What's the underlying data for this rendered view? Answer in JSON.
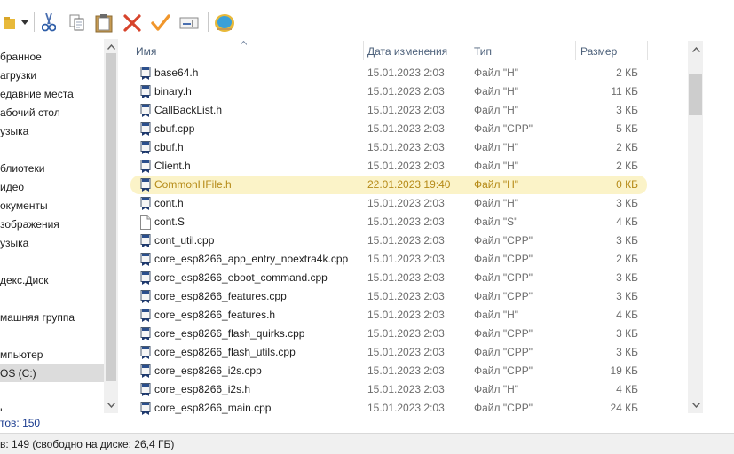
{
  "toolbar": {
    "icons": [
      "folder-icon",
      "dropdown-icon",
      "cut-icon",
      "copy-icon",
      "paste-icon",
      "delete-icon",
      "check-icon",
      "rename-icon",
      "shell-icon"
    ],
    "accent": "#d7442c"
  },
  "nav": {
    "items": [
      {
        "label": "бранное"
      },
      {
        "label": "агрузки"
      },
      {
        "label": "едавние места"
      },
      {
        "label": "абочий стол"
      },
      {
        "label": "узыка"
      },
      {
        "label": "блиотеки"
      },
      {
        "label": "идео"
      },
      {
        "label": "окументы"
      },
      {
        "label": "зображения"
      },
      {
        "label": "узыка"
      },
      {
        "label": "декс.Диск"
      },
      {
        "label": "машняя группа"
      },
      {
        "label": "мпьютер"
      },
      {
        "label": "OS (C:)"
      },
      {
        "label": "ь"
      }
    ],
    "status": "тов: 150"
  },
  "list": {
    "columns": {
      "name": "Имя",
      "date": "Дата изменения",
      "type": "Тип",
      "size": "Размер"
    },
    "rows": [
      {
        "name": "base64.h",
        "date": "15.01.2023 2:03",
        "type": "Файл \"H\"",
        "size": "2 КБ",
        "icon": "header-file"
      },
      {
        "name": "binary.h",
        "date": "15.01.2023 2:03",
        "type": "Файл \"H\"",
        "size": "11 КБ",
        "icon": "header-file"
      },
      {
        "name": "CallBackList.h",
        "date": "15.01.2023 2:03",
        "type": "Файл \"H\"",
        "size": "3 КБ",
        "icon": "header-file"
      },
      {
        "name": "cbuf.cpp",
        "date": "15.01.2023 2:03",
        "type": "Файл \"CPP\"",
        "size": "5 КБ",
        "icon": "header-file"
      },
      {
        "name": "cbuf.h",
        "date": "15.01.2023 2:03",
        "type": "Файл \"H\"",
        "size": "2 КБ",
        "icon": "header-file"
      },
      {
        "name": "Client.h",
        "date": "15.01.2023 2:03",
        "type": "Файл \"H\"",
        "size": "2 КБ",
        "icon": "header-file"
      },
      {
        "name": "CommonHFile.h",
        "date": "22.01.2023 19:40",
        "type": "Файл \"H\"",
        "size": "0 КБ",
        "icon": "header-file",
        "highlight": true
      },
      {
        "name": "cont.h",
        "date": "15.01.2023 2:03",
        "type": "Файл \"H\"",
        "size": "3 КБ",
        "icon": "header-file"
      },
      {
        "name": "cont.S",
        "date": "15.01.2023 2:03",
        "type": "Файл \"S\"",
        "size": "4 КБ",
        "icon": "blank-file"
      },
      {
        "name": "cont_util.cpp",
        "date": "15.01.2023 2:03",
        "type": "Файл \"CPP\"",
        "size": "3 КБ",
        "icon": "header-file"
      },
      {
        "name": "core_esp8266_app_entry_noextra4k.cpp",
        "date": "15.01.2023 2:03",
        "type": "Файл \"CPP\"",
        "size": "2 КБ",
        "icon": "header-file"
      },
      {
        "name": "core_esp8266_eboot_command.cpp",
        "date": "15.01.2023 2:03",
        "type": "Файл \"CPP\"",
        "size": "3 КБ",
        "icon": "header-file"
      },
      {
        "name": "core_esp8266_features.cpp",
        "date": "15.01.2023 2:03",
        "type": "Файл \"CPP\"",
        "size": "3 КБ",
        "icon": "header-file"
      },
      {
        "name": "core_esp8266_features.h",
        "date": "15.01.2023 2:03",
        "type": "Файл \"H\"",
        "size": "4 КБ",
        "icon": "header-file"
      },
      {
        "name": "core_esp8266_flash_quirks.cpp",
        "date": "15.01.2023 2:03",
        "type": "Файл \"CPP\"",
        "size": "3 КБ",
        "icon": "header-file"
      },
      {
        "name": "core_esp8266_flash_utils.cpp",
        "date": "15.01.2023 2:03",
        "type": "Файл \"CPP\"",
        "size": "3 КБ",
        "icon": "header-file"
      },
      {
        "name": "core_esp8266_i2s.cpp",
        "date": "15.01.2023 2:03",
        "type": "Файл \"CPP\"",
        "size": "19 КБ",
        "icon": "header-file"
      },
      {
        "name": "core_esp8266_i2s.h",
        "date": "15.01.2023 2:03",
        "type": "Файл \"H\"",
        "size": "4 КБ",
        "icon": "header-file"
      },
      {
        "name": "core_esp8266_main.cpp",
        "date": "15.01.2023 2:03",
        "type": "Файл \"CPP\"",
        "size": "24 КБ",
        "icon": "header-file"
      }
    ]
  },
  "statusbar": {
    "text": "в: 149 (свободно на диске: 26,4 ГБ)"
  }
}
